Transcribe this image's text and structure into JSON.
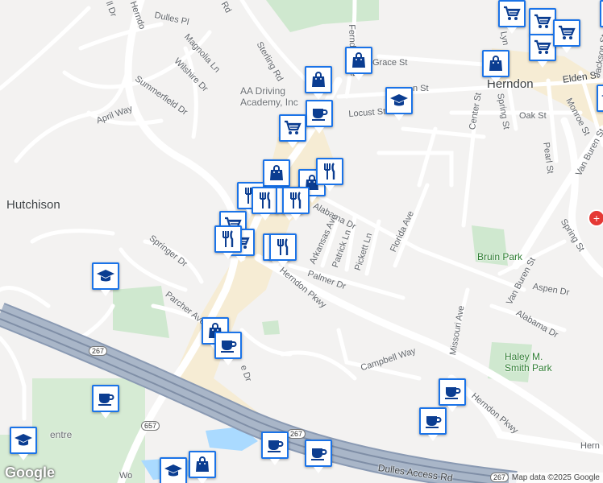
{
  "map": {
    "logo": "Google",
    "attribution": "Map data ©2025 Google",
    "places": {
      "hutchison": "Hutchison",
      "herndon": "Herndon",
      "bruin_park": "Bruin Park",
      "haley_park": "Haley M.\nSmith Park",
      "aa_driving": "AA Driving\nAcademy, Inc",
      "centre": "entre"
    },
    "streets": {
      "dulles_pl": "Dulles Pl",
      "magnolia": "Magnolia Ln",
      "wilshire": "Wilshire Dr",
      "summerfield": "Summerfield Dr",
      "april": "April Way",
      "sterling": "Sterling Rd",
      "springer": "Springer Dr",
      "parcher": "Parcher Ave",
      "alabama1": "Alabama Dr",
      "arkansas": "Arkansas Ave",
      "patrick": "Patrick Ln",
      "pickett": "Pickett Ln",
      "florida": "Florida Ave",
      "palmer": "Palmer Dr",
      "herndon_pkwy1": "Herndon Pkwy",
      "herndon_pkwy2": "Herndon Pkwy",
      "herndon_pkwy3": "Hern",
      "campbell": "Campbell Way",
      "missouri": "Missouri Ave",
      "alabama2": "Alabama Dr",
      "aspen": "Aspen Dr",
      "van_buren1": "Van Buren St",
      "van_buren2": "Van Buren St",
      "spring1": "Spring St",
      "spring2": "Spring St",
      "center": "Center St",
      "pearl": "Pearl St",
      "oak": "Oak St",
      "locust": "Locust St",
      "elden": "Elden St",
      "monroe": "Monroe St",
      "jackson": "Jackson St",
      "lynn": "Lyn",
      "grace": "Grace St",
      "elden_top": "n St",
      "dulles_access": "Dulles Access Rd",
      "rd_top": "Rd",
      "herndon_top": "Herndo",
      "ferndale": "Ferndale Ave",
      "e_dr": "e Dr",
      "wo": "Wo",
      "il": "ll Dr"
    },
    "shields": [
      "267",
      "657",
      "267",
      "267"
    ]
  }
}
